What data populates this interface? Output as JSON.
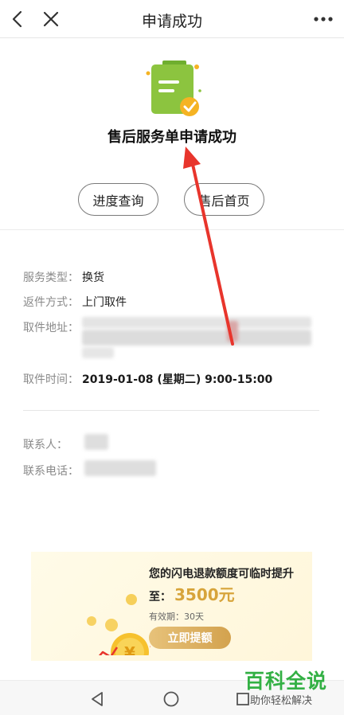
{
  "nav": {
    "title": "申请成功"
  },
  "hero": {
    "title": "售后服务单申请成功"
  },
  "actions": {
    "progress_label": "进度查询",
    "home_label": "售后首页"
  },
  "details": {
    "service_type_label": "服务类型：",
    "service_type_value": "换货",
    "return_method_label": "返件方式：",
    "return_method_value": "上门取件",
    "pickup_address_label": "取件地址：",
    "pickup_time_label": "取件时间：",
    "pickup_time_value": "2019-01-08 (星期二) 9:00-15:00",
    "contact_label": "联系人：",
    "phone_label": "联系电话："
  },
  "promo": {
    "line1": "您的闪电退款额度可临时提升",
    "prefix": "至：",
    "amount": "3500元",
    "validity": "有效期：30天",
    "button": "立即提额"
  },
  "watermark": {
    "main": "百科全说",
    "sub": "助你轻松解决"
  },
  "colors": {
    "accent_green": "#8cc43f",
    "badge_orange": "#f5b323",
    "promo_gold": "#d7a43a",
    "annotation_red": "#e8352c",
    "watermark_green": "#33b044"
  }
}
